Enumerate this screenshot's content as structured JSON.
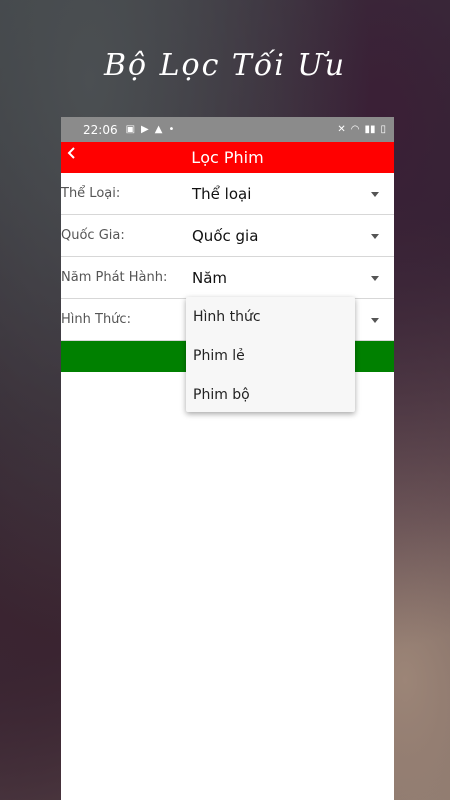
{
  "promo": {
    "title": "Bộ Lọc Tối Ưu"
  },
  "status_bar": {
    "time": "22:06"
  },
  "toolbar": {
    "title": "Lọc Phim"
  },
  "filters": [
    {
      "label": "Thể Loại:",
      "value": "Thể loại"
    },
    {
      "label": "Quốc Gia:",
      "value": "Quốc gia"
    },
    {
      "label": "Năm Phát Hành:",
      "value": "Năm"
    },
    {
      "label": "Hình Thức:",
      "value": ""
    }
  ],
  "popup": {
    "options": [
      "Hình thức",
      "Phim lẻ",
      "Phim bộ"
    ]
  },
  "colors": {
    "toolbar": "#ff0000",
    "apply_button": "#008000",
    "status_bar": "#8b8b8b"
  }
}
